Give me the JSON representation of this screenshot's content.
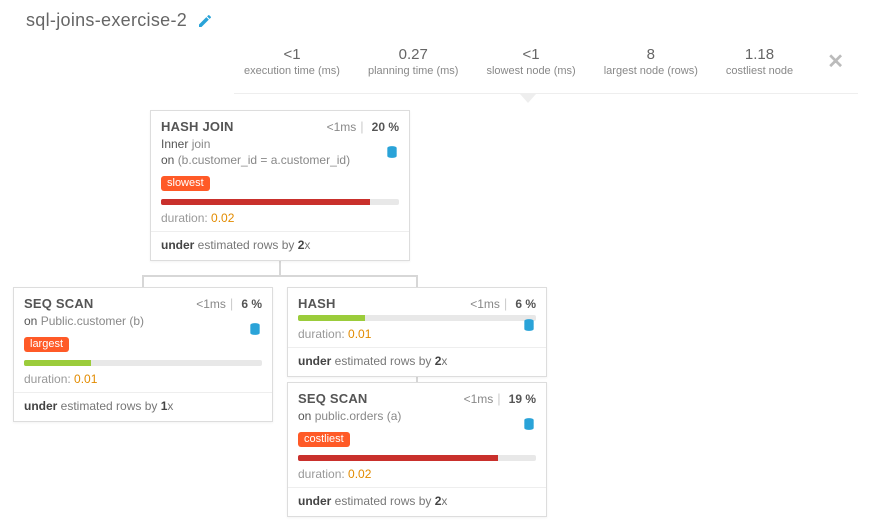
{
  "title": "sql-joins-exercise-2",
  "stats": {
    "exec_time": {
      "value": "<1",
      "label": "execution time (ms)"
    },
    "plan_time": {
      "value": "0.27",
      "label": "planning time (ms)"
    },
    "slowest": {
      "value": "<1",
      "label": "slowest node (ms)"
    },
    "largest": {
      "value": "8",
      "label": "largest node (rows)"
    },
    "costliest": {
      "value": "1.18",
      "label": "costliest node"
    }
  },
  "nodes": {
    "hashjoin": {
      "title": "HASH JOIN",
      "time": "<1ms",
      "pct": "20 %",
      "sub1_a": "Inner ",
      "sub1_b": "join",
      "sub2_a": "on ",
      "sub2_b": "(b.customer_id = a.customer_id)",
      "badge": "slowest",
      "bar_pct": 88,
      "bar_color": "red",
      "dur_label": "duration: ",
      "dur_value": "0.02",
      "est_a": "under ",
      "est_b": "estimated rows by ",
      "est_c": "2",
      "est_d": "x"
    },
    "seqscan_cust": {
      "title": "SEQ SCAN",
      "time": "<1ms",
      "pct": "6 %",
      "sub_a": "on ",
      "sub_b": "Public.customer (b)",
      "badge": "largest",
      "bar_pct": 28,
      "bar_color": "green",
      "dur_label": "duration: ",
      "dur_value": "0.01",
      "est_a": "under ",
      "est_b": "estimated rows by ",
      "est_c": "1",
      "est_d": "x"
    },
    "hash": {
      "title": "HASH",
      "time": "<1ms",
      "pct": "6 %",
      "bar_pct": 28,
      "bar_color": "green",
      "dur_label": "duration: ",
      "dur_value": "0.01",
      "est_a": "under ",
      "est_b": "estimated rows by ",
      "est_c": "2",
      "est_d": "x"
    },
    "seqscan_orders": {
      "title": "SEQ SCAN",
      "time": "<1ms",
      "pct": "19 %",
      "sub_a": "on ",
      "sub_b": "public.orders (a)",
      "badge": "costliest",
      "bar_pct": 84,
      "bar_color": "red",
      "dur_label": "duration: ",
      "dur_value": "0.02",
      "est_a": "under ",
      "est_b": "estimated rows by ",
      "est_c": "2",
      "est_d": "x"
    }
  }
}
